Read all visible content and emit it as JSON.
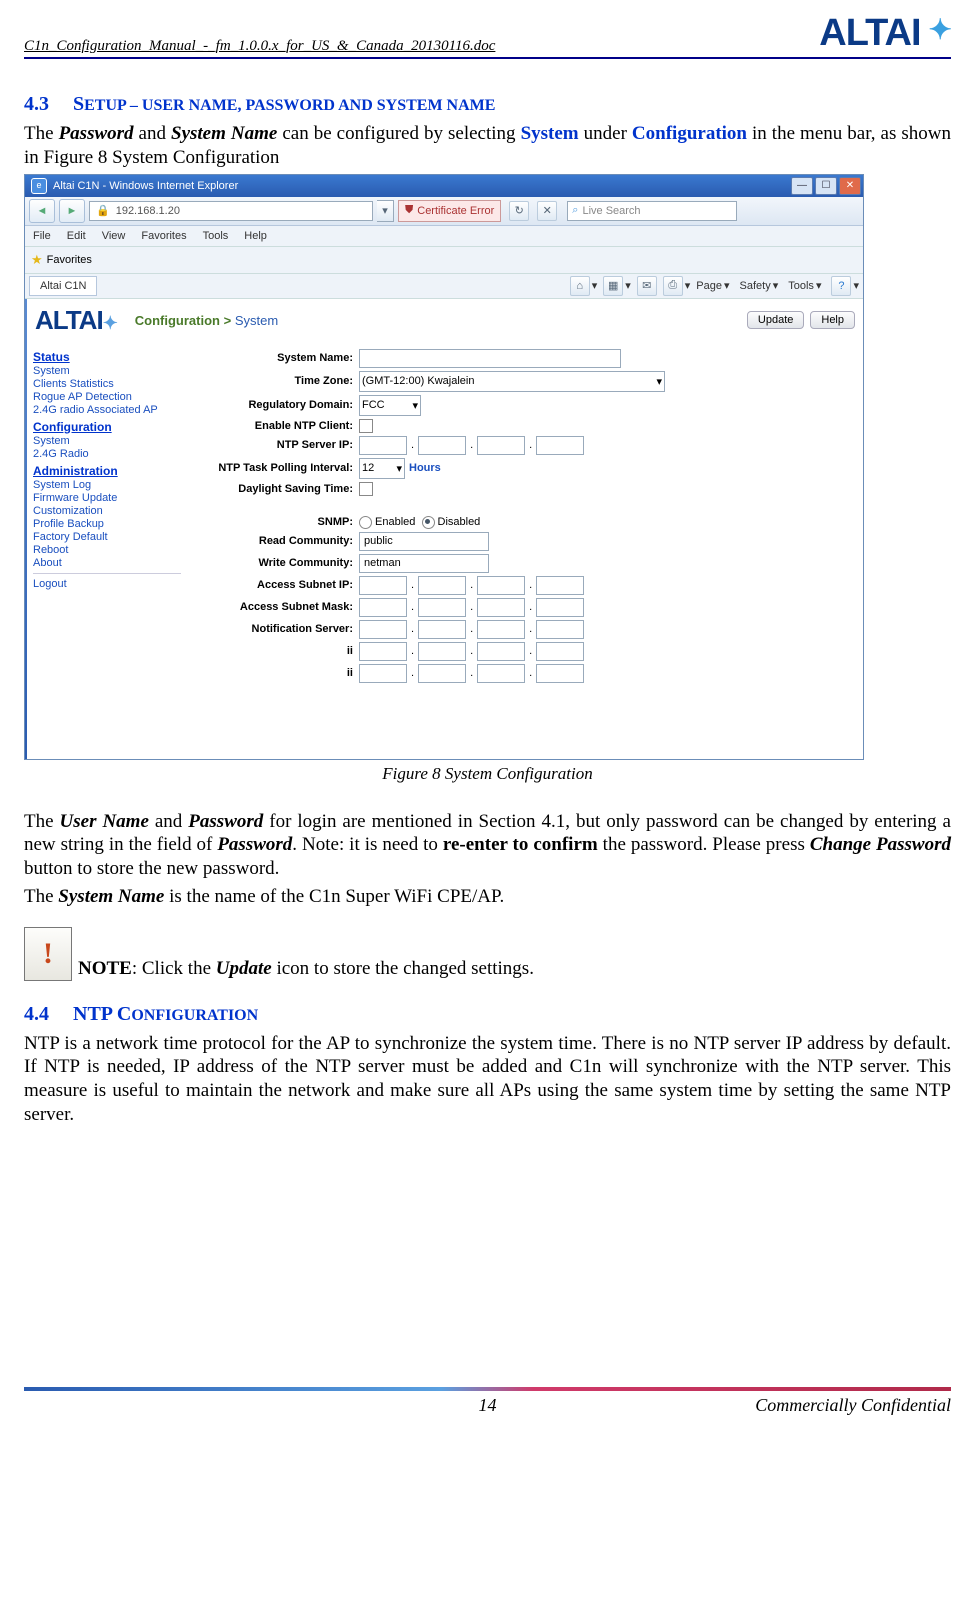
{
  "header": {
    "doc_name": "C1n_Configuration_Manual_-_fm_1.0.0.x_for_US_&_Canada_20130116.doc",
    "logo_text": "ALTAI"
  },
  "section43": {
    "num": "4.3",
    "title_first": "S",
    "title_rest": "ETUP – USER NAME, PASSWORD AND SYSTEM NAME",
    "para1_a": "The ",
    "para1_b": "Password",
    "para1_c": " and ",
    "para1_d": "System Name",
    "para1_e": " can be configured by selecting ",
    "para1_f": "System",
    "para1_g": " under ",
    "para1_h": "Configuration",
    "para1_i": " in the menu bar, as shown in Figure 8    System Configuration"
  },
  "ie": {
    "title": "Altai C1N - Windows Internet Explorer",
    "url": "192.168.1.20",
    "cert_err": "Certificate Error",
    "search_placeholder": "Live Search",
    "menus": [
      "File",
      "Edit",
      "View",
      "Favorites",
      "Tools",
      "Help"
    ],
    "fav_label": "Favorites",
    "tab_label": "Altai C1N",
    "tb_links": [
      "Page",
      "Safety",
      "Tools"
    ],
    "brand_logo": "ALTAI",
    "breadcrumb_a": "Configuration > ",
    "breadcrumb_b": "System",
    "btn_update": "Update",
    "btn_help": "Help",
    "sidebar": {
      "status_head": "Status",
      "status_items": [
        "System",
        "Clients Statistics",
        "Rogue AP Detection",
        "2.4G radio Associated AP"
      ],
      "config_head": "Configuration",
      "config_items": [
        "System",
        "2.4G Radio"
      ],
      "admin_head": "Administration",
      "admin_items": [
        "System Log",
        "Firmware Update",
        "Customization",
        "Profile Backup",
        "Factory Default",
        "Reboot",
        "About"
      ],
      "logout": "Logout"
    },
    "form": {
      "system_name": "System Name:",
      "time_zone": "Time Zone:",
      "time_zone_val": "(GMT-12:00) Kwajalein",
      "reg_domain": "Regulatory Domain:",
      "reg_domain_val": "FCC",
      "enable_ntp": "Enable NTP Client:",
      "ntp_server": "NTP Server IP:",
      "ntp_poll": "NTP Task Polling Interval:",
      "ntp_poll_val": "12",
      "hours": "Hours",
      "dst": "Daylight Saving Time:",
      "snmp": "SNMP:",
      "snmp_en": "Enabled",
      "snmp_dis": "Disabled",
      "read_comm": "Read Community:",
      "read_comm_val": "public",
      "write_comm": "Write Community:",
      "write_comm_val": "netman",
      "acc_subnet_ip": "Access Subnet IP:",
      "acc_subnet_mask": "Access Subnet Mask:",
      "notif_server": "Notification Server:",
      "ii": "ii"
    }
  },
  "figure_caption": "Figure 8    System Configuration",
  "post_fig": {
    "p1_a": "The ",
    "p1_b": "User Name",
    "p1_c": " and ",
    "p1_d": "Password",
    "p1_e": " for login are mentioned in Section 4.1, but only password can be changed by entering a new string in the field of ",
    "p1_f": "Password",
    "p1_g": ".    Note: it is need to ",
    "p1_h": "re-enter to confirm",
    "p1_i": " the password. Please press ",
    "p1_j": "Change Password",
    "p1_k": " button to store the new password.",
    "p2_a": "The ",
    "p2_b": "System Name",
    "p2_c": " is the name of the C1n Super WiFi CPE/AP."
  },
  "note": {
    "label": "NOTE",
    "rest_a": ": Click the ",
    "rest_b": "Update",
    "rest_c": " icon to store the changed settings."
  },
  "section44": {
    "num": "4.4",
    "title": "NTP CONFIGURATION",
    "para": "NTP is a network time protocol for the AP to synchronize the system time. There is no NTP server IP address by default. If NTP is needed, IP address of the NTP server must be added and C1n will synchronize with the NTP server. This measure is useful to maintain the network and make sure all APs using the same system time by setting the same NTP server."
  },
  "footer": {
    "page": "14",
    "conf": "Commercially Confidential"
  }
}
